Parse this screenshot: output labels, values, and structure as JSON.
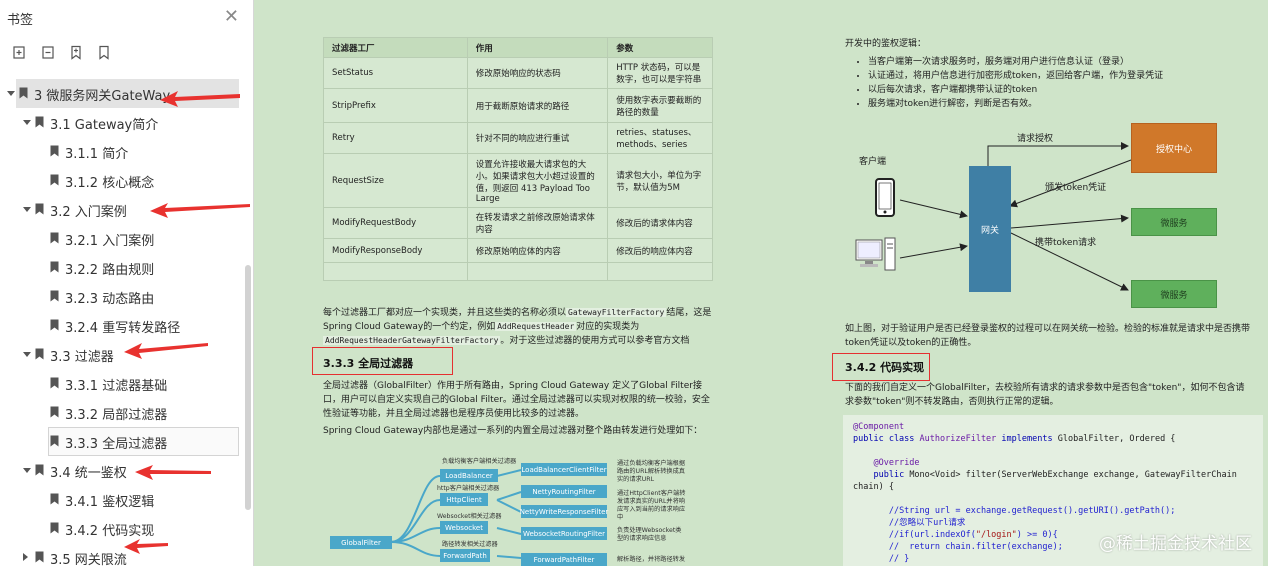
{
  "sidebar": {
    "title": "书签",
    "close_icon": "close-icon",
    "tools": [
      "expand-all-icon",
      "collapse-all-icon",
      "add-bookmark-icon",
      "bookmark-icon"
    ],
    "items": [
      {
        "label": "3 微服务网关GateWay",
        "level": 0,
        "expanded": true,
        "selected": true
      },
      {
        "label": "3.1 Gateway简介",
        "level": 1,
        "expanded": true
      },
      {
        "label": "3.1.1 简介",
        "level": 2
      },
      {
        "label": "3.1.2 核心概念",
        "level": 2
      },
      {
        "label": "3.2 入门案例",
        "level": 1,
        "expanded": true
      },
      {
        "label": "3.2.1 入门案例",
        "level": 2
      },
      {
        "label": "3.2.2 路由规则",
        "level": 2
      },
      {
        "label": "3.2.3 动态路由",
        "level": 2
      },
      {
        "label": "3.2.4 重写转发路径",
        "level": 2
      },
      {
        "label": "3.3 过滤器",
        "level": 1,
        "expanded": true
      },
      {
        "label": "3.3.1 过滤器基础",
        "level": 2
      },
      {
        "label": "3.3.2 局部过滤器",
        "level": 2
      },
      {
        "label": "3.3.3 全局过滤器",
        "level": 2,
        "focused": true
      },
      {
        "label": "3.4 统一鉴权",
        "level": 1,
        "expanded": true
      },
      {
        "label": "3.4.1 鉴权逻辑",
        "level": 2
      },
      {
        "label": "3.4.2 代码实现",
        "level": 2
      },
      {
        "label": "3.5 网关限流",
        "level": 1,
        "expanded": false
      }
    ]
  },
  "table": {
    "headers": [
      "过滤器工厂",
      "作用",
      "参数"
    ],
    "rows": [
      [
        "SetStatus",
        "修改原始响应的状态码",
        "HTTP 状态码，可以是数字，也可以是字符串"
      ],
      [
        "StripPrefix",
        "用于截断原始请求的路径",
        "使用数字表示要截断的路径的数量"
      ],
      [
        "Retry",
        "针对不同的响应进行重试",
        "retries、statuses、methods、series"
      ],
      [
        "RequestSize",
        "设置允许接收最大请求包的大小。如果请求包大小超过设置的值，则返回 413 Payload Too Large",
        "请求包大小，单位为字节，默认值为5M"
      ],
      [
        "ModifyRequestBody",
        "在转发请求之前修改原始请求体内容",
        "修改后的请求体内容"
      ],
      [
        "ModifyResponseBody",
        "修改原始响应体的内容",
        "修改后的响应体内容"
      ],
      [
        "",
        "",
        ""
      ]
    ]
  },
  "left_text": {
    "p1a": "每个过滤器工厂都对应一个实现类，并且这些类的名称必须以",
    "p1b": "GatewayFilterFactory",
    "p1c": "结尾，这是Spring Cloud Gateway的一个约定，例如",
    "p1d": "AddRequestHeader",
    "p1e": "对应的实现类为",
    "p1f": "AddRequestHeaderGatewayFilterFactory",
    "p1g": "。对于这些过滤器的使用方式可以参考官方文档",
    "heading": "3.3.3 全局过滤器",
    "p2": "全局过滤器（GlobalFilter）作用于所有路由，Spring Cloud Gateway 定义了Global Filter接口，用户可以自定义实现自己的Global Filter。通过全局过滤器可以实现对权限的统一校验，安全性验证等功能，并且全局过滤器也是程序员使用比较多的过滤器。",
    "p3": "Spring Cloud Gateway内部也是通过一系列的内置全局过滤器对整个路由转发进行处理如下："
  },
  "mini_diagram": {
    "root": "GlobalFilter",
    "branch_labels": [
      "负载均衡客户端相关过滤器",
      "http客户端相关过滤器",
      "Websocket相关过滤器",
      "路径转发相关过滤器"
    ],
    "mid": [
      "LoadBalancer",
      "HttpClient",
      "Websocket",
      "ForwardPath"
    ],
    "right": [
      "LoadBalancerClientFilter",
      "NettyRoutingFilter",
      "NettyWriteResponseFilter",
      "WebsocketRoutingFilter",
      "ForwardPathFilter"
    ],
    "notes": [
      "通过负载均衡客户端根据路由的URL解析转换成真实的请求URL",
      "通过HttpClient客户端转发请求真实的URL并将响应写入到当前的请求响应中",
      "负责处理Websocket类型的请求响应信息",
      "解析路径，并将路径转发"
    ]
  },
  "right_text": {
    "intro": "开发中的鉴权逻辑：",
    "bullets": [
      "当客户端第一次请求服务时，服务端对用户进行信息认证（登录）",
      "认证通过，将用户信息进行加密形成token，返回给客户端，作为登录凭证",
      "以后每次请求，客户端都携带认证的token",
      "服务端对token进行解密，判断是否有效。"
    ],
    "after_diagram": "如上图，对于验证用户是否已经登录鉴权的过程可以在网关统一检验。检验的标准就是请求中是否携带token凭证以及token的正确性。",
    "heading": "3.4.2 代码实现",
    "p2": "下面的我们自定义一个GlobalFilter，去校验所有请求的请求参数中是否包含\"token\"，如何不包含请求参数\"token\"则不转发路由，否则执行正常的逻辑。"
  },
  "auth_diagram": {
    "client_label": "客户端",
    "gateway": "网关",
    "auth_center": "授权中心",
    "service1": "微服务",
    "service2": "微服务",
    "edge_request_auth": "请求授权",
    "edge_issue_token": "颁发token凭证",
    "edge_carry_token": "携带token请求",
    "colors": {
      "gateway": "#3f7fa5",
      "auth_center": "#d0782a",
      "service": "#5fb05c"
    }
  },
  "code": {
    "l1": "@Component",
    "l2a": "public class ",
    "l2b": "AuthorizeFilter",
    "l2c": " implements ",
    "l2d": "GlobalFilter, Ordered {",
    "l3": "@Override",
    "l4a": "public ",
    "l4b": "Mono<Void>",
    "l4c": " filter(ServerWebExchange exchange, GatewayFilterChain",
    "l5": "chain) {",
    "l6": "//String url = exchange.getRequest().getURI().getPath();",
    "l7": "//忽略以下url请求",
    "l8a": "//if(url.indexOf(",
    "l8b": "\"/login\"",
    "l8c": ") >= 0){",
    "l9": "//  return chain.filter(exchange);",
    "l10": "// }"
  },
  "watermark": "@稀土掘金技术社区"
}
